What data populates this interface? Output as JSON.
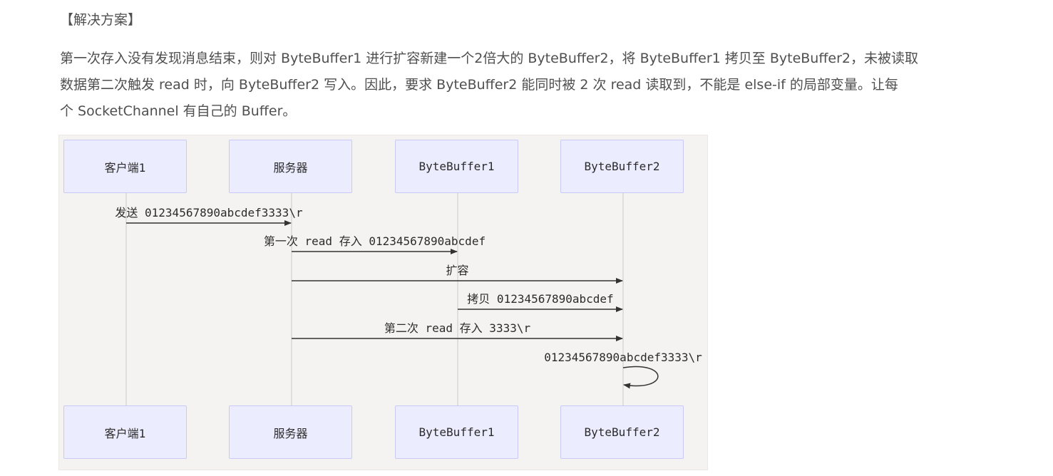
{
  "article": {
    "heading": "【解决方案】",
    "paragraph_lines": [
      "第一次存入没有发现消息结束，则对 ByteBuffer1 进行扩容新建一个2倍大的 ByteBuffer2，将 ByteBuffer1 拷贝至 ByteBuffer2，未被读取",
      "数据第二次触发 read 时，向 ByteBuffer2 写入。因此，要求 ByteBuffer2 能同时被 2 次 read 读取到，不能是 else-if 的局部变量。让每",
      "个 SocketChannel 有自己的 Buffer。"
    ]
  },
  "diagram": {
    "type": "sequence",
    "participants": [
      "客户端1",
      "服务器",
      "ByteBuffer1",
      "ByteBuffer2"
    ],
    "messages": [
      {
        "from": 0,
        "to": 1,
        "text": "发送 01234567890abcdef3333\\r"
      },
      {
        "from": 1,
        "to": 2,
        "text": "第一次 read 存入 01234567890abcdef"
      },
      {
        "from": 1,
        "to": 3,
        "text": "扩容"
      },
      {
        "from": 2,
        "to": 3,
        "text": "拷贝 01234567890abcdef"
      },
      {
        "from": 1,
        "to": 3,
        "text": "第二次 read 存入 3333\\r"
      },
      {
        "from": 3,
        "to": 3,
        "text": "01234567890abcdef3333\\r"
      }
    ],
    "colors": {
      "actor_fill": "#ececff",
      "actor_border": "#c9c9f5",
      "background": "#f4f3f1",
      "lifeline": "#c8c8c8",
      "arrow": "#333333"
    }
  }
}
